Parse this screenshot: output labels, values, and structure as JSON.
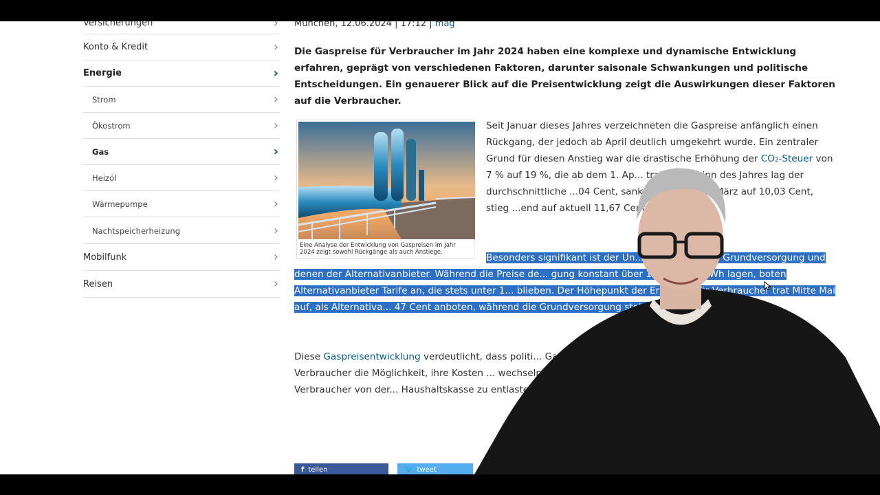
{
  "sidebar": {
    "items": [
      {
        "label": "Versicherungen",
        "level": "top",
        "active": false
      },
      {
        "label": "Konto & Kredit",
        "level": "top",
        "active": false
      },
      {
        "label": "Energie",
        "level": "top",
        "active": true
      },
      {
        "label": "Strom",
        "level": "sub",
        "active": false
      },
      {
        "label": "Ökostrom",
        "level": "sub",
        "active": false
      },
      {
        "label": "Gas",
        "level": "sub",
        "active": true
      },
      {
        "label": "Heizöl",
        "level": "sub",
        "active": false
      },
      {
        "label": "Wärmepumpe",
        "level": "sub",
        "active": false
      },
      {
        "label": "Nachtspeicherheizung",
        "level": "sub",
        "active": false
      },
      {
        "label": "Mobilfunk",
        "level": "top",
        "active": false
      },
      {
        "label": "Reisen",
        "level": "top",
        "active": false
      }
    ],
    "chevron_icon": "chevron-right-icon"
  },
  "article": {
    "meta_date": "München, 12.06.2024 | 17:12 |",
    "meta_author": "mag",
    "lead": "Die Gaspreise für Verbraucher im Jahr 2024 haben eine komplexe und dynamische Entwicklung erfahren, geprägt von verschiedenen Faktoren, darunter saisonale Schwankungen und politische Entscheidungen. Ein genauerer Blick auf die Preisentwicklung zeigt die Auswirkungen dieser Faktoren auf die Verbraucher.",
    "image_caption": "Eine Analyse der Entwicklung von Gaspreisen im Jahr 2024 zeigt sowohl Rückgänge als auch Anstiege.",
    "p1_a": "Seit Januar dieses Jahres verzeichneten die Gaspreise anfänglich einen Rückgang, der jedoch ab April deutlich umgekehrt wurde. Ein zentraler Grund für diesen Anstieg war die drastische Erhöhung der ",
    "p1_link": "CO₂-Steuer",
    "p1_b": " von 7 % auf 19 %, die ab dem 1. Ap... trat. Zu Beginn des Jahres lag der durchschnittliche ...04 Cent, sank dann bis Mitte März auf 10,03 Cent, stieg ...end auf aktuell 11,67 Cent pro kWh an.",
    "p2": "Besonders signifikant ist der Un... den Preisen der Grundversorgung und denen der Alternativanbieter. Während die Preise de... gung konstant über 12 Cent pro kWh lagen, boten Alternativanbieter Tarife an, die stets unter 1... blieben. Der Höhepunkt der Ersparnis für Verbraucher trat Mitte Mai auf, als Alternativa... 47 Cent anboten, während die Grundversorgung stolze 12,97 Cent...",
    "p3_a": "Diese ",
    "p3_link": "Gaspreisentwicklung",
    "p3_b": " verdeutlicht, dass politi... Gaspreise haben. Die steigende CO₂-Steuer ist hi... haben Verbraucher die Möglichkeit, ihre Kosten ... wechseln. Die Gaspreisentwicklung im Jahr 2... die Notwendigkeit für Verbraucher von der... Haushaltskasse zu entlasten."
  },
  "share": {
    "facebook_label": "teilen",
    "facebook_icon": "facebook-icon",
    "twitter_label": "tweet",
    "twitter_icon": "twitter-icon"
  }
}
